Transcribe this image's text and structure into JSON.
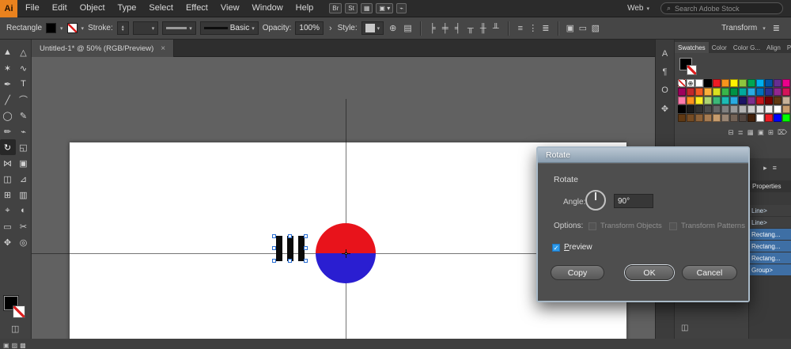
{
  "menubar": {
    "app_icon": "Ai",
    "items": [
      "File",
      "Edit",
      "Object",
      "Type",
      "Select",
      "Effect",
      "View",
      "Window",
      "Help"
    ],
    "quick_icons": [
      {
        "name": "bridge-icon",
        "glyph": "Br"
      },
      {
        "name": "stock-icon",
        "glyph": "St"
      },
      {
        "name": "arrange-documents-icon",
        "glyph": "▦"
      },
      {
        "name": "document-layout-icon",
        "glyph": "▣ ▾"
      },
      {
        "name": "gpu-performance-icon",
        "glyph": "⌁"
      }
    ],
    "workspace_label": "Web",
    "workspace_caret": "▾",
    "search_icon": "⌕",
    "search_placeholder": "Search Adobe Stock"
  },
  "controlbar": {
    "context_label": "Rectangle",
    "caret": "▾",
    "stepper_up": "▲",
    "stepper_down": "▼",
    "stroke_label": "Stroke:",
    "stroke_style_label": "Basic",
    "opacity_label": "Opacity:",
    "opacity_value": "100%",
    "opacity_more": "›",
    "style_label": "Style:",
    "globe_icon": "⊕",
    "doc_icon": "▤",
    "transform_label": "Transform",
    "menu_icon": "≣",
    "align_icons": [
      {
        "name": "align-left-icon",
        "glyph": "╞"
      },
      {
        "name": "align-center-horizontal-icon",
        "glyph": "╪"
      },
      {
        "name": "align-right-icon",
        "glyph": "╡"
      },
      {
        "name": "align-top-icon",
        "glyph": "╥"
      },
      {
        "name": "align-middle-vertical-icon",
        "glyph": "╫"
      },
      {
        "name": "align-bottom-icon",
        "glyph": "╨"
      }
    ],
    "distribute_icons": [
      {
        "name": "distribute-vertical-icon",
        "glyph": "≡"
      },
      {
        "name": "distribute-horizontal-icon",
        "glyph": "⋮"
      },
      {
        "name": "distribute-spacing-icon",
        "glyph": "≣"
      }
    ],
    "extra_icons": [
      {
        "name": "align-to-artboard-icon",
        "glyph": "▣"
      },
      {
        "name": "shape-properties-icon",
        "glyph": "▭"
      },
      {
        "name": "isolate-selection-icon",
        "glyph": "▧"
      }
    ]
  },
  "tabbar": {
    "title": "Untitled-1* @ 50% (RGB/Preview)",
    "close_icon": "×"
  },
  "toolbar": {
    "tools": [
      {
        "name": "selection-tool",
        "glyph": "▲"
      },
      {
        "name": "direct-selection-tool",
        "glyph": "△"
      },
      {
        "name": "magic-wand-tool",
        "glyph": "✶"
      },
      {
        "name": "lasso-tool",
        "glyph": "∿"
      },
      {
        "name": "pen-tool",
        "glyph": "✒"
      },
      {
        "name": "type-tool",
        "glyph": "T"
      },
      {
        "name": "line-segment-tool",
        "glyph": "╱"
      },
      {
        "name": "curvature-tool",
        "glyph": "⌒"
      },
      {
        "name": "ellipse-tool",
        "glyph": "◯"
      },
      {
        "name": "paintbrush-tool",
        "glyph": "✎"
      },
      {
        "name": "pencil-tool",
        "glyph": "✏"
      },
      {
        "name": "shaper-tool",
        "glyph": "⌁"
      },
      {
        "name": "rotate-tool",
        "glyph": "↻",
        "selected": true
      },
      {
        "name": "scale-tool",
        "glyph": "◱"
      },
      {
        "name": "width-tool",
        "glyph": "⋈"
      },
      {
        "name": "free-transform-tool",
        "glyph": "▣"
      },
      {
        "name": "shape-builder-tool",
        "glyph": "◫"
      },
      {
        "name": "perspective-grid-tool",
        "glyph": "⊿"
      },
      {
        "name": "mesh-tool",
        "glyph": "⊞"
      },
      {
        "name": "gradient-tool",
        "glyph": "▥"
      },
      {
        "name": "eyedropper-tool",
        "glyph": "⌖"
      },
      {
        "name": "blend-tool",
        "glyph": "◐"
      },
      {
        "name": "artboard-tool",
        "glyph": "▭"
      },
      {
        "name": "slice-tool",
        "glyph": "✂"
      },
      {
        "name": "hand-tool",
        "glyph": "✥"
      },
      {
        "name": "zoom-tool",
        "glyph": "◎"
      }
    ],
    "draw_mode_icons": [
      {
        "name": "draw-normal-icon",
        "glyph": "▣"
      },
      {
        "name": "draw-behind-icon",
        "glyph": "▨"
      },
      {
        "name": "draw-inside-icon",
        "glyph": "▩"
      }
    ],
    "screen_mode_icon": "◫"
  },
  "canvas": {
    "circle_top_color": "#e8131b",
    "circle_bottom_color": "#2a1ed1"
  },
  "dialog": {
    "title": "Rotate",
    "section_label": "Rotate",
    "angle_label": "Angle:",
    "angle_value": "90°",
    "options_label": "Options:",
    "option_objects": "Transform Objects",
    "option_patterns": "Transform Patterns",
    "preview_label": "Preview",
    "check_glyph": "✓",
    "copy_button": "Copy",
    "ok_button": "OK",
    "cancel_button": "Cancel",
    "accent_checkbox_color": "#2f9bea"
  },
  "panels": {
    "strip_icons": [
      {
        "name": "character-panel-icon",
        "glyph": "A"
      },
      {
        "name": "paragraph-panel-icon",
        "glyph": "¶"
      },
      {
        "name": "glyphs-panel-icon",
        "glyph": "O"
      },
      {
        "name": "libraries-panel-icon",
        "glyph": "✥"
      },
      {
        "name": "strip-spacer",
        "spacer": true
      },
      {
        "name": "appearance-panel-icon",
        "glyph": "▤"
      },
      {
        "name": "layers-panel-icon",
        "glyph": "▦"
      }
    ],
    "swatches": {
      "tabs": [
        {
          "label": "Swatches",
          "active": true
        },
        {
          "label": "Color",
          "active": false
        },
        {
          "label": "Color G...",
          "active": false
        },
        {
          "label": "Align",
          "active": false
        },
        {
          "label": "Pa",
          "active": false
        }
      ],
      "reg_glyph": "⊕",
      "rows": [
        [
          "none",
          "reg",
          "#ffffff",
          "#000000",
          "#ed1c24",
          "#f7941d",
          "#fff200",
          "#8dc63f",
          "#00a651",
          "#00aeef",
          "#0054a6",
          "#662d91",
          "#ec008c"
        ],
        [
          "#9e005d",
          "#c1272d",
          "#f15a24",
          "#fbb03b",
          "#d9e021",
          "#39b54a",
          "#009245",
          "#00a99d",
          "#29abe2",
          "#0071bc",
          "#2e3192",
          "#93278f",
          "#d4145a"
        ],
        [
          "#ff7bac",
          "#ff931e",
          "#fcee21",
          "#acd373",
          "#3cb878",
          "#1cbbb4",
          "#29aae1",
          "#1b1464",
          "#7b2e8d",
          "#c4161c",
          "#790000",
          "#603913",
          "#c7b299"
        ],
        [
          "#000000",
          "#1a1a1a",
          "#333333",
          "#4d4d4d",
          "#666666",
          "#808080",
          "#999999",
          "#b3b3b3",
          "#cccccc",
          "#e6e6e6",
          "#f2f2f2",
          "#ffffff",
          "#c69c6d"
        ],
        [
          "#603913",
          "#754c24",
          "#8c6239",
          "#a67c52",
          "#c69c6d",
          "#998675",
          "#736357",
          "#534741",
          "#42210b",
          "#ffffff",
          "#ed1c24",
          "#0000ff",
          "#00ff00"
        ]
      ],
      "footer_icons": [
        {
          "name": "swatch-libraries-icon",
          "glyph": "⊟"
        },
        {
          "name": "swatch-kinds-icon",
          "glyph": "≣"
        },
        {
          "name": "swatch-options-icon",
          "glyph": "▦"
        },
        {
          "name": "new-color-group-icon",
          "glyph": "▣"
        },
        {
          "name": "new-swatch-icon",
          "glyph": "⊞"
        },
        {
          "name": "delete-swatch-icon",
          "glyph": "⌦"
        }
      ]
    },
    "side_icons": [
      {
        "name": "panel-collapse-icon",
        "glyph": "▸"
      },
      {
        "name": "panel-menu-icon",
        "glyph": "≡"
      }
    ],
    "properties_label": "Properties",
    "layer_items": [
      {
        "label": "Line>",
        "selected": false
      },
      {
        "label": "Line>",
        "selected": false
      },
      {
        "label": "Rectang...",
        "selected": true
      },
      {
        "label": "Rectang...",
        "selected": true
      },
      {
        "label": "Rectang...",
        "selected": true
      },
      {
        "label": "Group>",
        "selected": true
      }
    ],
    "bottom_icon": "◫"
  }
}
